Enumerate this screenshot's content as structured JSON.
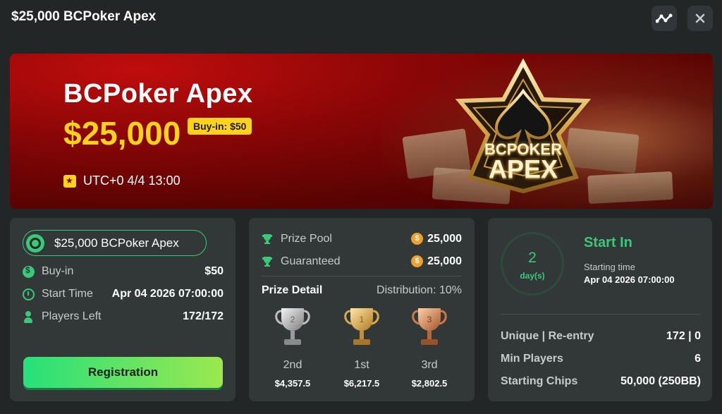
{
  "header": {
    "title": "$25,000 BCPoker Apex",
    "stats_icon": "trend-line-icon",
    "close_icon": "close-icon"
  },
  "banner": {
    "title": "BCPoker Apex",
    "amount": "$25,000",
    "buyin_badge": "Buy-in: $50",
    "date": "UTC+0 4/4 13:00",
    "logo_line1": "BCPOKER",
    "logo_line2": "APEX"
  },
  "info": {
    "tournament_name": "$25,000 BCPoker Apex",
    "rows": [
      {
        "label": "Buy-in",
        "value": "$50",
        "icon": "coin-icon"
      },
      {
        "label": "Start Time",
        "value": "Apr 04 2026 07:00:00",
        "icon": "clock-icon"
      },
      {
        "label": "Players Left",
        "value": "172/172",
        "icon": "person-icon"
      }
    ],
    "register_label": "Registration"
  },
  "prize": {
    "pool_label": "Prize Pool",
    "pool_value": "25,000",
    "guaranteed_label": "Guaranteed",
    "guaranteed_value": "25,000",
    "coin_symbol": "$",
    "detail_title": "Prize Detail",
    "distribution": "Distribution: 10%",
    "places": [
      {
        "place": "2nd",
        "rank": "2",
        "prize": "$4,357.5",
        "color": "silver"
      },
      {
        "place": "1st",
        "rank": "1",
        "prize": "$6,217.5",
        "color": "gold"
      },
      {
        "place": "3rd",
        "rank": "3",
        "prize": "$2,802.5",
        "color": "bronze"
      }
    ]
  },
  "countdown": {
    "number": "2",
    "unit": "day(s)",
    "title": "Start In",
    "starting_label": "Starting time",
    "starting_value": "Apr 04 2026 07:00:00",
    "rows": [
      {
        "label": "Unique | Re-entry",
        "value": "172 | 0"
      },
      {
        "label": "Min Players",
        "value": "6"
      },
      {
        "label": "Starting Chips",
        "value": "50,000 (250BB)"
      }
    ]
  },
  "colors": {
    "background": "#232626",
    "card": "#323738",
    "accent_green": "#3bc87a",
    "banner_red": "#8a0606",
    "banner_yellow": "#ffd21e",
    "coin_orange": "#f0a032"
  }
}
